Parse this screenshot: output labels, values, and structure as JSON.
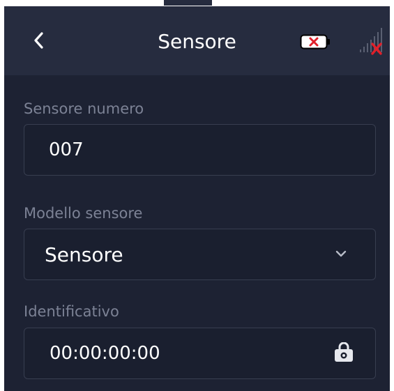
{
  "header": {
    "title": "Sensore"
  },
  "fields": {
    "sensor_number": {
      "label": "Sensore numero",
      "value": "007"
    },
    "sensor_model": {
      "label": "Modello sensore",
      "value": "Sensore"
    },
    "identifier": {
      "label": "Identificativo",
      "value": "00:00:00:00"
    }
  },
  "icons": {
    "back": "chevron-left-icon",
    "battery": "battery-error-icon",
    "signal": "no-signal-icon",
    "dropdown": "chevron-down-icon",
    "lock": "lock-icon"
  },
  "colors": {
    "background": "#1d2233",
    "header": "#262c3f",
    "label": "#7c8295",
    "error": "#e0202a"
  }
}
